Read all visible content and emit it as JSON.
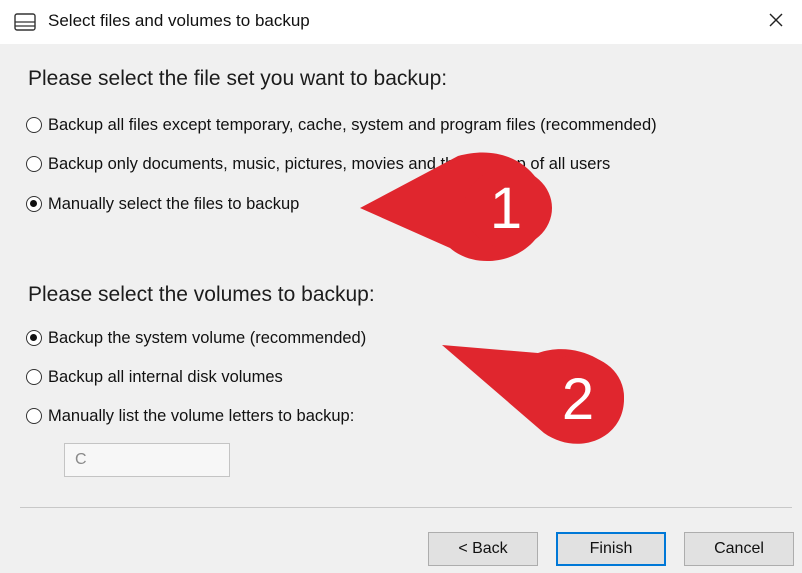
{
  "window": {
    "title": "Select files and volumes to backup"
  },
  "fileset": {
    "heading": "Please select the file set you want to backup:",
    "options": [
      {
        "label": "Backup all files except temporary, cache, system and program files (recommended)",
        "selected": false
      },
      {
        "label": "Backup only documents, music, pictures, movies and the desktop of all users",
        "selected": false
      },
      {
        "label": "Manually select the files to backup",
        "selected": true
      }
    ]
  },
  "volumes": {
    "heading": "Please select the volumes to backup:",
    "options": [
      {
        "label": "Backup the system volume (recommended)",
        "selected": true
      },
      {
        "label": "Backup all internal disk volumes",
        "selected": false
      },
      {
        "label": "Manually list the volume letters to backup:",
        "selected": false
      }
    ],
    "volume_letters_value": "C"
  },
  "buttons": {
    "back": "< Back",
    "finish": "Finish",
    "cancel": "Cancel"
  },
  "callouts": {
    "first": "1",
    "second": "2",
    "color": "#e0262e"
  }
}
